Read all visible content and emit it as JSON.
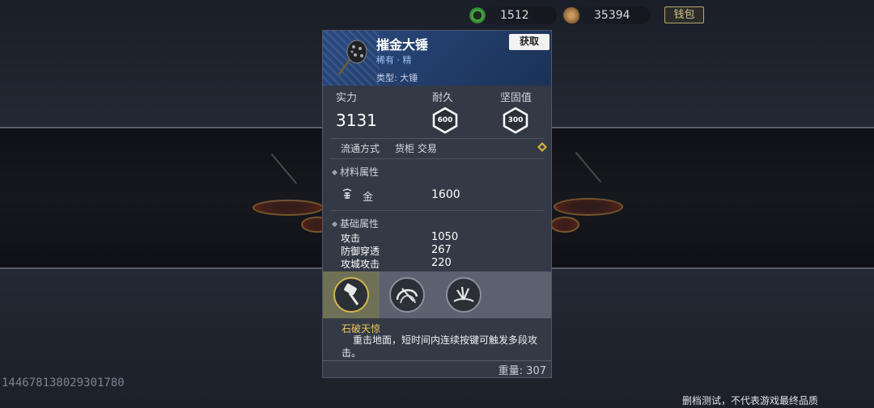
{
  "currencies": [
    {
      "icon": "jade-coin-icon",
      "value": "1512",
      "color": "#4db04a"
    },
    {
      "icon": "copper-coin-icon",
      "value": "35394",
      "color": "#a57a44"
    }
  ],
  "wallet_label": "钱包",
  "item": {
    "icon": "hammer-icon",
    "name": "摧金大锤",
    "rarity": "稀有 · 精",
    "type": "类型: 大锤",
    "get_label": "获取"
  },
  "stats": {
    "power_label": "实力",
    "power_value": "3131",
    "durability_label": "耐久",
    "durability_value": "600",
    "toughness_label": "坚固值",
    "toughness_value": "300"
  },
  "circulation": {
    "label": "流通方式",
    "methods": "货柜 交易"
  },
  "material": {
    "title": "材料属性",
    "name": "金",
    "value": "1600"
  },
  "base_attrs": {
    "title": "基础属性",
    "rows": [
      {
        "name": "攻击",
        "value": "1050"
      },
      {
        "name": "防御穿透",
        "value": "267"
      },
      {
        "name": "攻城攻击",
        "value": "220"
      }
    ]
  },
  "skills": [
    {
      "icon": "hammer-strike-icon",
      "selected": true
    },
    {
      "icon": "spin-slash-icon",
      "selected": false
    },
    {
      "icon": "ground-burst-icon",
      "selected": false
    }
  ],
  "skill_detail": {
    "name": "石破天惊",
    "desc": "重击地面，短时间内连续按键可触发多段攻击。"
  },
  "weight": "重量: 307",
  "player_id": "144678138029301780",
  "notice": "删档测试，不代表游戏最终品质"
}
